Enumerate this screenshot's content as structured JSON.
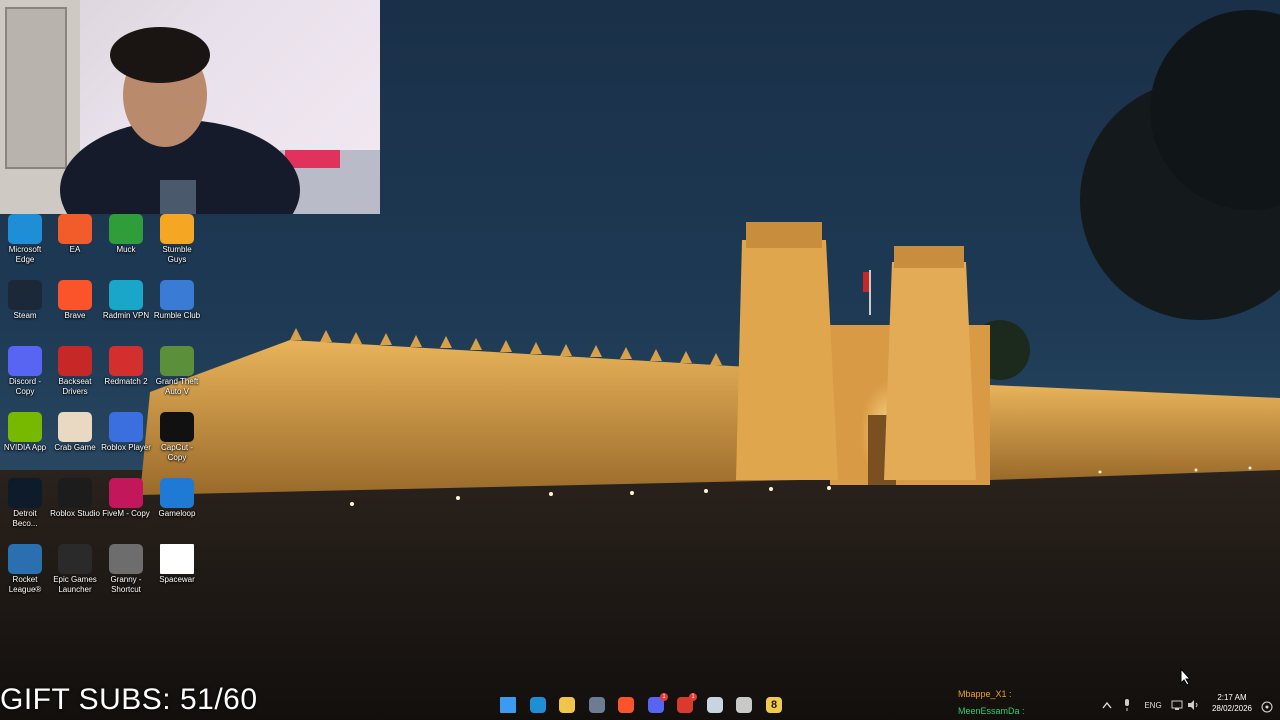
{
  "overlay": {
    "gift_subs": "GIFT SUBS: 51/60"
  },
  "desktop_icons": [
    {
      "label": "Microsoft Edge",
      "icon": "edge-icon",
      "color": "#1e8fd6"
    },
    {
      "label": "EA",
      "icon": "ea-icon",
      "color": "#f25c2a"
    },
    {
      "label": "Muck",
      "icon": "muck-icon",
      "color": "#2f9e3a"
    },
    {
      "label": "Stumble Guys",
      "icon": "stumble-guys-icon",
      "color": "#f5a623"
    },
    {
      "label": "Steam",
      "icon": "steam-icon",
      "color": "#1b2838"
    },
    {
      "label": "Brave",
      "icon": "brave-icon",
      "color": "#fb542b"
    },
    {
      "label": "Radmin VPN",
      "icon": "radmin-vpn-icon",
      "color": "#1aa6c9"
    },
    {
      "label": "Rumble Club",
      "icon": "rumble-club-icon",
      "color": "#3a7bd5"
    },
    {
      "label": "Discord - Copy",
      "icon": "discord-icon",
      "color": "#5865f2"
    },
    {
      "label": "Backseat Drivers",
      "icon": "backseat-drivers-icon",
      "color": "#c62828"
    },
    {
      "label": "Redmatch 2",
      "icon": "redmatch-icon",
      "color": "#d32f2f"
    },
    {
      "label": "Grand Theft Auto V",
      "icon": "gta-v-icon",
      "color": "#5b8f3a"
    },
    {
      "label": "NVIDIA App",
      "icon": "nvidia-icon",
      "color": "#76b900"
    },
    {
      "label": "Crab Game",
      "icon": "crab-game-icon",
      "color": "#e9d9c3"
    },
    {
      "label": "Roblox Player",
      "icon": "roblox-player-icon",
      "color": "#3b6fe0"
    },
    {
      "label": "CapCut - Copy",
      "icon": "capcut-icon",
      "color": "#111111"
    },
    {
      "label": "Detroit Beco...",
      "icon": "detroit-icon",
      "color": "#0d1b2a"
    },
    {
      "label": "Roblox Studio",
      "icon": "roblox-studio-icon",
      "color": "#1c1c1c"
    },
    {
      "label": "FiveM - Copy",
      "icon": "fivem-icon",
      "color": "#c2185b"
    },
    {
      "label": "Gameloop",
      "icon": "gameloop-icon",
      "color": "#1f7ad6"
    },
    {
      "label": "Rocket League®",
      "icon": "rocket-league-icon",
      "color": "#2a6fb0"
    },
    {
      "label": "Epic Games Launcher",
      "icon": "epic-games-icon",
      "color": "#2a2a2a"
    },
    {
      "label": "Granny - Shortcut",
      "icon": "granny-icon",
      "color": "#6d6d6d"
    },
    {
      "label": "Spacewar",
      "icon": "file-icon",
      "color": "#ffffff"
    }
  ],
  "taskbar": {
    "apps": [
      {
        "name": "start-button",
        "icon": "windows-icon",
        "color": "#3a9bf0"
      },
      {
        "name": "edge",
        "icon": "edge-icon",
        "color": "#1e8fd6"
      },
      {
        "name": "file-explorer",
        "icon": "folder-icon",
        "color": "#f2c44c"
      },
      {
        "name": "store",
        "icon": "store-icon",
        "color": "#6b7c93"
      },
      {
        "name": "brave",
        "icon": "brave-icon",
        "color": "#fb542b"
      },
      {
        "name": "discord",
        "icon": "discord-icon",
        "color": "#5865f2",
        "badge": "1"
      },
      {
        "name": "game-red",
        "icon": "game-icon",
        "color": "#d93a2b",
        "badge": "1"
      },
      {
        "name": "steam",
        "icon": "steam-icon",
        "color": "#c7d5e0"
      },
      {
        "name": "settings",
        "icon": "gear-icon",
        "color": "#c9c9c9"
      },
      {
        "name": "app-8",
        "icon": "app-8-icon",
        "color": "#f2c94c",
        "text": "8"
      }
    ],
    "chat": [
      {
        "name": "Mbappe_X1 :",
        "color": "#f0a020"
      },
      {
        "name": "MeenEssamDa :",
        "color": "#2ecc71"
      }
    ],
    "language": "ENG",
    "time": "2:17 AM",
    "date": "28/02/2026"
  }
}
